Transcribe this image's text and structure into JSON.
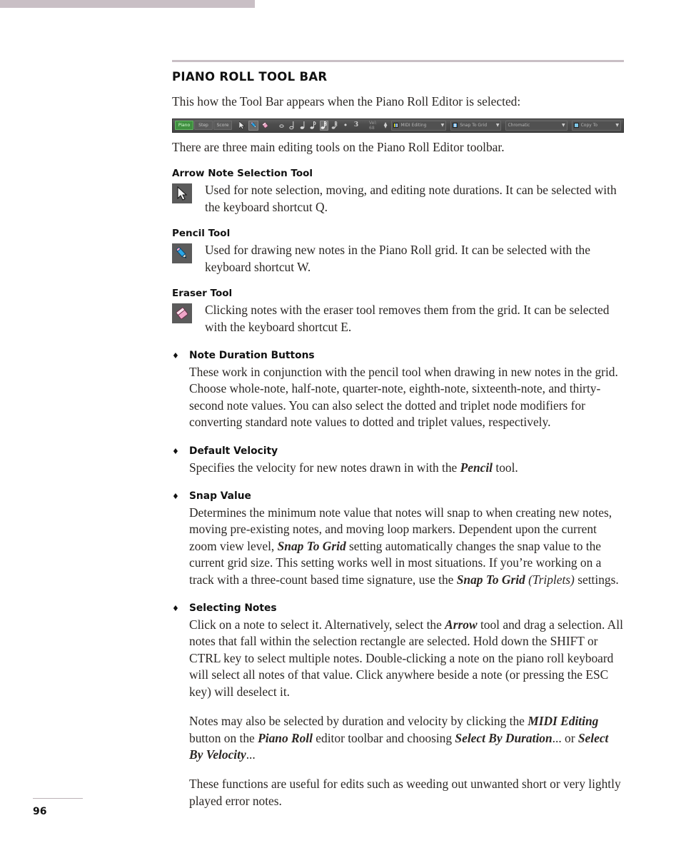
{
  "page": {
    "number": "96",
    "section_title": "PIANO ROLL TOOL BAR",
    "intro": "This how the Tool Bar appears when the Piano Roll Editor is selected:",
    "after_figure": "There are three main editing tools on the Piano Roll Editor toolbar."
  },
  "toolbar_figure": {
    "tabs": [
      {
        "label": "Piano",
        "active": true
      },
      {
        "label": "Step",
        "active": false
      },
      {
        "label": "Score",
        "active": false
      }
    ],
    "tools": [
      {
        "name": "arrow-tool",
        "glyph": "➤",
        "selected": false
      },
      {
        "name": "pencil-tool",
        "glyph": "✎",
        "selected": true
      },
      {
        "name": "eraser-tool",
        "glyph": "▰",
        "selected": false
      }
    ],
    "note_buttons": [
      {
        "name": "whole-note",
        "glyph": "𝅝",
        "selected": false
      },
      {
        "name": "half-note",
        "glyph": "♩",
        "selected": false
      },
      {
        "name": "quarter-note",
        "glyph": "♩",
        "selected": false
      },
      {
        "name": "eighth-note",
        "glyph": "♪",
        "selected": false
      },
      {
        "name": "sixteenth-note",
        "glyph": "♫",
        "selected": true
      },
      {
        "name": "thirty-second-note",
        "glyph": "♬",
        "selected": false
      },
      {
        "name": "dotted-modifier",
        "glyph": "•",
        "selected": false
      },
      {
        "name": "triplet-modifier",
        "glyph": "3",
        "selected": false
      }
    ],
    "velocity_label": "Vel: 68",
    "dropdowns": [
      {
        "name": "midi-editing",
        "label": "MIDI Editing",
        "swatch": "sw-midi"
      },
      {
        "name": "snap-to-grid",
        "label": "Snap To Grid",
        "swatch": "sw-snap"
      },
      {
        "name": "chromatic",
        "label": "Chromatic",
        "swatch": ""
      },
      {
        "name": "copy-to",
        "label": "Copy To",
        "swatch": "sw-copy"
      }
    ],
    "arrow_glyph": "▼"
  },
  "tools": [
    {
      "heading": "Arrow Note Selection Tool",
      "icon": "arrow-cursor-icon",
      "description": "Used for note selection, moving, and editing note durations. It can be selected with the keyboard shortcut Q."
    },
    {
      "heading": "Pencil Tool",
      "icon": "pencil-icon",
      "description": "Used for drawing new notes in the Piano Roll grid. It can be selected with the keyboard shortcut W."
    },
    {
      "heading": "Eraser Tool",
      "icon": "eraser-icon",
      "description": "Clicking notes with the eraser tool removes them from the grid. It can be selected with the keyboard shortcut E."
    }
  ],
  "bullets": [
    {
      "marker": "♦",
      "heading": "Note Duration Buttons",
      "paragraphs": [
        "These work in conjunction with the pencil tool when drawing in new notes in the grid. Choose whole-note, half-note, quarter-note, eighth-note, sixteenth-note, and thirty-second note values. You can also select the dotted and triplet node modifiers for converting standard note values to dotted and triplet values, respectively."
      ]
    },
    {
      "marker": "♦",
      "heading": "Default Velocity",
      "paragraphs": [
        "Specifies the velocity for new notes drawn in with the Pencil tool."
      ]
    },
    {
      "marker": "♦",
      "heading": "Snap Value",
      "paragraphs": [
        "Determines the minimum note value that notes will snap to when creating new notes, moving pre-existing notes, and moving loop markers. Dependent upon the current zoom view level, Snap To Grid setting automatically changes the snap value to the current grid size. This setting works well in most situations. If you're working on a track with a three-count based time signature, use the Snap To Grid (Triplets) settings."
      ]
    },
    {
      "marker": "♦",
      "heading": "Selecting Notes",
      "paragraphs": [
        "Click on a note to select it. Alternatively, select the Arrow tool and drag a selection. All notes that fall within the selection rectangle are selected. Hold down the SHIFT or CTRL key to select multiple notes. Double-clicking a note on the piano roll keyboard will select all notes of that value. Click anywhere beside a note (or pressing the ESC key) will deselect it.",
        "Notes may also be selected by duration and velocity by clicking the MIDI Editing button on the Piano Roll editor toolbar and choosing Select By Duration... or Select By Velocity...",
        "These functions are useful for edits such as weeding out unwanted short or very lightly played error notes."
      ]
    }
  ],
  "emphasis": {
    "pencil": "Pencil",
    "snap_to_grid": "Snap To Grid",
    "snap_to_grid_triplets_a": "Snap To Grid",
    "snap_to_grid_triplets_b": "(Triplets)",
    "arrow": "Arrow",
    "midi_editing": "MIDI Editing",
    "piano_roll": "Piano Roll",
    "select_by_duration": "Select By Duration",
    "select_by_velocity": "Select By Velocity"
  },
  "colors": {
    "accent_bar": "#c9bfc5",
    "text": "#2b2724",
    "heading": "#111111",
    "toolbar_bg": "#4c4c4c",
    "toolbar_active_tab": "#3f8f3f"
  }
}
